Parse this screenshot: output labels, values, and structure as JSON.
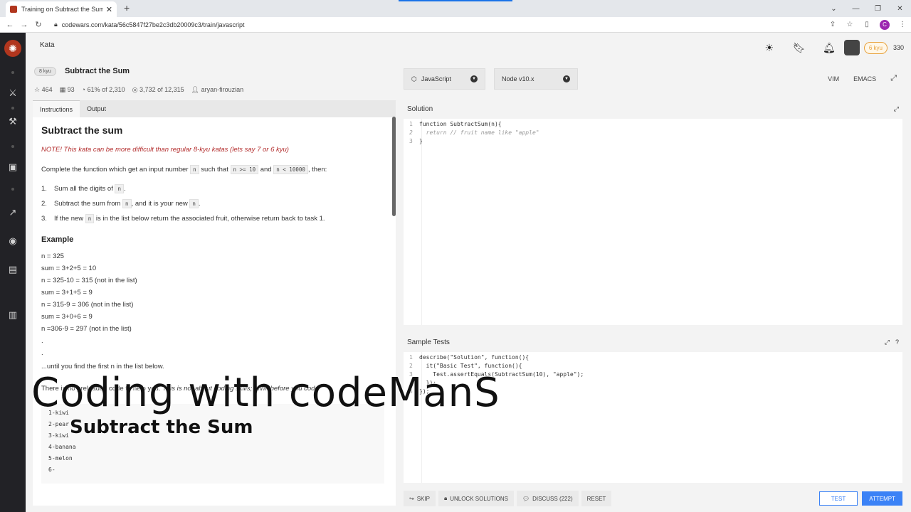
{
  "browser": {
    "tab_title": "Training on Subtract the Sum | C",
    "url": "codewars.com/kata/56c5847f27be2c3db20009c3/train/javascript"
  },
  "header": {
    "nav_label": "Kata",
    "rank_badge": "6 kyu",
    "honor": "330"
  },
  "kata": {
    "kyu": "8 kyu",
    "title": "Subtract the Sum",
    "stars": "464",
    "votes": "93",
    "satisfaction": "61% of 2,310",
    "completions": "3,732 of 12,315",
    "author": "aryan-firouzian"
  },
  "left_tabs": [
    "Instructions",
    "Output"
  ],
  "instructions": {
    "heading": "Subtract the sum",
    "note": "NOTE! This kata can be more difficult than regular 8-kyu katas (lets say 7 or 6 kyu)",
    "intro_a": "Complete the function which get an input number ",
    "intro_code1": "n",
    "intro_b": " such that ",
    "intro_code2": "n >= 10",
    "intro_c": " and ",
    "intro_code3": "n < 10000",
    "intro_d": ", then:",
    "steps": [
      {
        "num": "1.",
        "a": "Sum all the digits of ",
        "code": "n",
        "b": "."
      },
      {
        "num": "2.",
        "a": "Subtract the sum from ",
        "code": "n",
        "b": ", and it is your new ",
        "code2": "n",
        "c": "."
      },
      {
        "num": "3.",
        "a": "If the new ",
        "code": "n",
        "b": " is in the list below return the associated fruit, otherwise return back to task 1."
      }
    ],
    "example_heading": "Example",
    "example_lines": [
      "n = 325",
      "sum = 3+2+5 = 10",
      "n = 325-10 = 315 (not in the list)",
      "sum = 3+1+5 = 9",
      "n = 315-9 = 306 (not in the list)",
      "sum = 3+0+6 = 9",
      "n =306-9 = 297 (not in the list)",
      ".",
      "."
    ],
    "until_line": "...until you find the first n in the list below.",
    "preload_a": "There is no preloaded code to help you. ",
    "preload_b": "This is not about coding skills; think before you code",
    "fruits": [
      "1-kiwi",
      "2-pear",
      "3-kiwi",
      "4-banana",
      "5-melon",
      "6-"
    ]
  },
  "editor": {
    "language": "JavaScript",
    "runtime": "Node v10.x",
    "modes": [
      "VIM",
      "EMACS"
    ],
    "solution_label": "Solution",
    "sample_label": "Sample Tests",
    "solution_lines": [
      {
        "n": "1",
        "t": "function SubtractSum(n){"
      },
      {
        "n": "2",
        "t": "  return // fruit name like \"apple\""
      },
      {
        "n": "3",
        "t": "}"
      }
    ],
    "sample_lines": [
      {
        "n": "1",
        "t": "describe(\"Solution\", function(){"
      },
      {
        "n": "2",
        "t": "  it(\"Basic Test\", function(){"
      },
      {
        "n": "3",
        "t": "    Test.assertEquals(SubtractSum(10), \"apple\");"
      },
      {
        "n": "4",
        "t": "  });"
      },
      {
        "n": "5",
        "t": "});"
      }
    ]
  },
  "actions": {
    "skip": "SKIP",
    "unlock": "UNLOCK SOLUTIONS",
    "discuss": "DISCUSS (222)",
    "reset": "RESET",
    "test": "TEST",
    "attempt": "ATTEMPT"
  },
  "overlay": {
    "caption_main": "Coding with codeManS",
    "caption_sub": "Subtract the Sum"
  },
  "colors": {
    "brand": "#b1361e",
    "sidebar": "#222226",
    "accent_blue": "#3b82f6",
    "note_red": "#b32d2d"
  }
}
